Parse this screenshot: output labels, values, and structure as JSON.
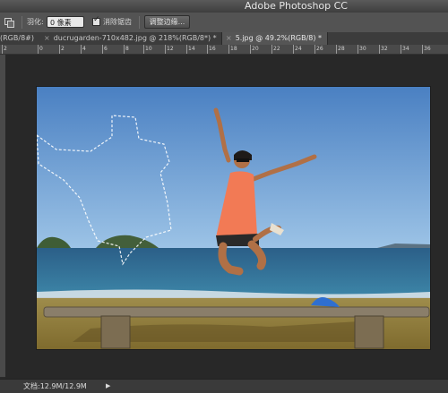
{
  "app": {
    "title": "Adobe Photoshop CC"
  },
  "options_bar": {
    "feather_label": "羽化:",
    "feather_value": "0 像素",
    "antialias_label": "消除锯齿",
    "antialias_checked": true,
    "refine_edge_label": "调整边缘..."
  },
  "tabs": [
    {
      "label": "(RGB/8#)",
      "active": false
    },
    {
      "label": "ducrugarden-710x482.jpg @ 218%(RGB/8*) *",
      "active": false
    },
    {
      "label": "5.jpg @ 49.2%(RGB/8) *",
      "active": true
    }
  ],
  "tab_close_glyph": "×",
  "ruler": {
    "ticks": [
      "2",
      "0",
      "2",
      "4",
      "6",
      "8",
      "10",
      "12",
      "14",
      "16",
      "18",
      "20",
      "22",
      "24",
      "26",
      "28",
      "30",
      "32",
      "34",
      "36"
    ]
  },
  "status": {
    "doc_size": "文档:12.9M/12.9M",
    "arrow": "▶"
  },
  "colors": {
    "sky": "#4f86c6",
    "sea": "#2f6f98",
    "sand": "#8d7c3a",
    "accent": "#f27a55"
  }
}
